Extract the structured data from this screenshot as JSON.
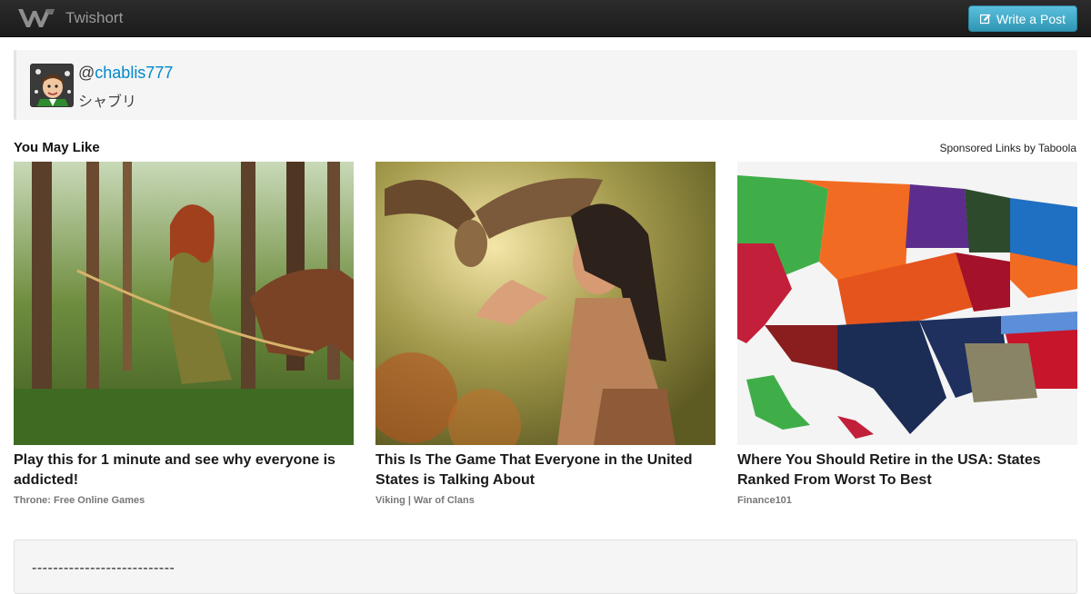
{
  "header": {
    "brand": "Twishort",
    "write_post_label": "Write a Post"
  },
  "profile": {
    "at": "@",
    "username": "chablis777",
    "display_name": "シャブリ"
  },
  "recommendations": {
    "title": "You May Like",
    "sponsor_label": "Sponsored Links by Taboola",
    "items": [
      {
        "headline": "Play this for 1 minute and see why everyone is addicted!",
        "source": "Throne: Free Online Games"
      },
      {
        "headline": "This Is The Game That Everyone in the United States is Talking About",
        "source": "Viking | War of Clans"
      },
      {
        "headline": "Where You Should Retire in the USA: States Ranked From Worst To Best",
        "source": "Finance101"
      }
    ]
  },
  "post": {
    "text": "---------------------------"
  },
  "colors": {
    "navbar": "#1b1b1b",
    "accent_button": "#49afcd",
    "link": "#0088cc"
  }
}
